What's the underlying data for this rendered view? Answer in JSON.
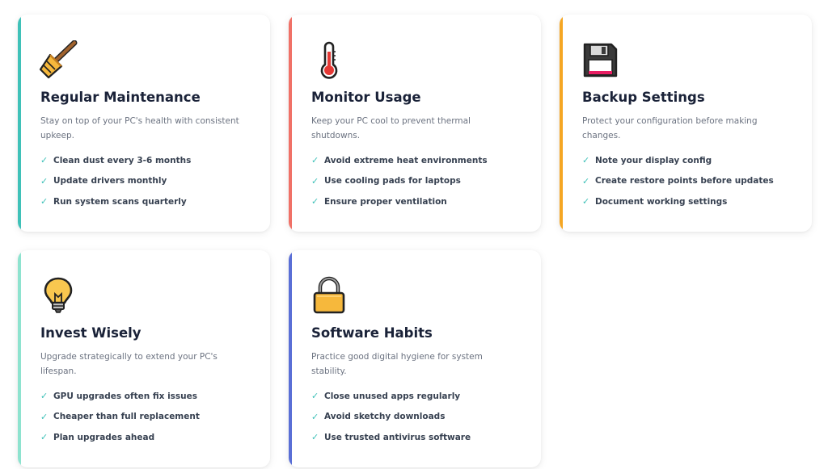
{
  "cards": [
    {
      "icon": "broom-icon",
      "accent": "#3fc1b8",
      "title": "Regular Maintenance",
      "description": "Stay on top of your PC's health with consistent upkeep.",
      "items": [
        "Clean dust every 3-6 months",
        "Update drivers monthly",
        "Run system scans quarterly"
      ]
    },
    {
      "icon": "thermometer-icon",
      "accent": "#f07167",
      "title": "Monitor Usage",
      "description": "Keep your PC cool to prevent thermal shutdowns.",
      "items": [
        "Avoid extreme heat environments",
        "Use cooling pads for laptops",
        "Ensure proper ventilation"
      ]
    },
    {
      "icon": "floppy-disk-icon",
      "accent": "#f5a623",
      "title": "Backup Settings",
      "description": "Protect your configuration before making changes.",
      "items": [
        "Note your display config",
        "Create restore points before updates",
        "Document working settings"
      ]
    },
    {
      "icon": "light-bulb-icon",
      "accent": "#8ee3cf",
      "title": "Invest Wisely",
      "description": "Upgrade strategically to extend your PC's lifespan.",
      "items": [
        "GPU upgrades often fix issues",
        "Cheaper than full replacement",
        "Plan upgrades ahead"
      ]
    },
    {
      "icon": "lock-icon",
      "accent": "#5a6fd6",
      "title": "Software Habits",
      "description": "Practice good digital hygiene for system stability.",
      "items": [
        "Close unused apps regularly",
        "Avoid sketchy downloads",
        "Use trusted antivirus software"
      ]
    }
  ],
  "check_glyph": "✓"
}
